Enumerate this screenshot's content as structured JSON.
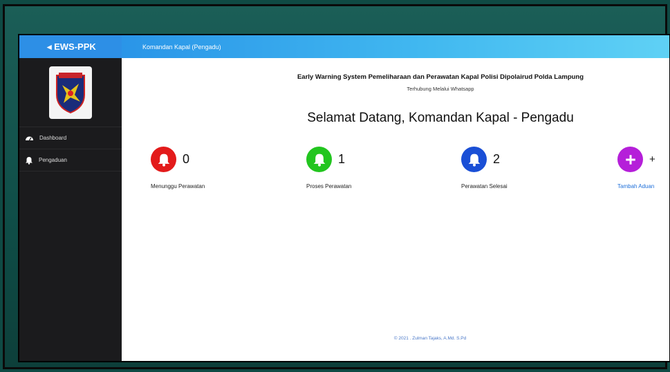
{
  "brand": {
    "name": "EWS-PPK"
  },
  "header": {
    "user_role": "Komandan Kapal (Pengadu)"
  },
  "sidebar": {
    "items": [
      {
        "label": "Dashboard",
        "icon": "dashboard-icon"
      },
      {
        "label": "Pengaduan",
        "icon": "bell-icon"
      }
    ]
  },
  "main": {
    "system_title": "Early Warning System Pemeliharaan dan Perawatan Kapal Polisi Dipolairud Polda Lampung",
    "subtitle": "Terhubung Melalui Whatsapp",
    "welcome": "Selamat Datang, Komandan Kapal - Pengadu",
    "stats": [
      {
        "count": "0",
        "label": "Menunggu Perawatan",
        "color": "#e31b1b",
        "icon": "bell-icon"
      },
      {
        "count": "1",
        "label": "Proses Perawatan",
        "color": "#22c51f",
        "icon": "bell-icon"
      },
      {
        "count": "2",
        "label": "Perawatan Selesai",
        "color": "#1a4fd6",
        "icon": "bell-icon"
      },
      {
        "count": "+",
        "label": "Tambah Aduan",
        "color": "#b51fd9",
        "icon": "plus-icon"
      }
    ],
    "footer": "© 2021 . Zulman Tajaks, A.Md. S.Pd"
  }
}
